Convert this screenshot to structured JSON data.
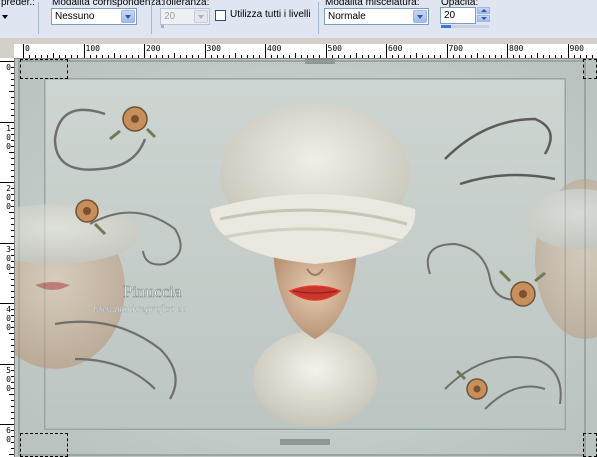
{
  "toolbar": {
    "preset_label": "preder.:",
    "match_mode_label": "Modalità corrispondenza:",
    "match_mode_value": "Nessuno",
    "tolerance_label": "Tolleranza:",
    "tolerance_value": "20",
    "use_all_layers_label": "Utilizza tutti i livelli",
    "use_all_layers_checked": false,
    "blend_mode_label": "Modalità miscelatura:",
    "blend_mode_value": "Normale",
    "opacity_label": "Opacità:",
    "opacity_value": "20",
    "opacity_fraction": 0.2
  },
  "ruler": {
    "horizontal_labels": [
      "0",
      "100",
      "200",
      "300",
      "400",
      "500",
      "600",
      "700",
      "800",
      "900"
    ],
    "vertical_labels": [
      [
        "0"
      ],
      [
        "1",
        "0",
        "0"
      ],
      [
        "2",
        "0",
        "0"
      ],
      [
        "3",
        "0",
        "0"
      ],
      [
        "4",
        "0",
        "0"
      ],
      [
        "5",
        "0",
        "0"
      ],
      [
        "6",
        "0"
      ]
    ]
  },
  "canvas": {
    "watermark_title": "Pinuccia",
    "watermark_url": "www.maidiregrafica.eu",
    "colors": {
      "background": "#c9d0cc",
      "frame": "#b6c0bd",
      "lips": "#c9372c",
      "scarf": "#e8e6dc",
      "flower": "#c7905a"
    }
  }
}
